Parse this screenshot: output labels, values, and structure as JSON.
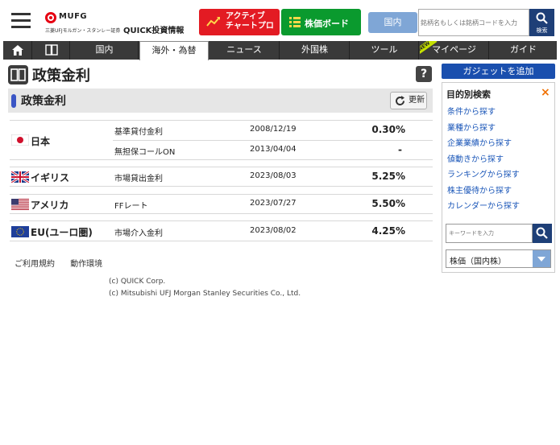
{
  "header": {
    "logo_mufg": "MUFG",
    "logo_sub": "三菱UFJモルガン・スタンレー証券",
    "logo_quick": "QUICK投資情報",
    "active_chart_line1": "アクティブ",
    "active_chart_line2": "チャートプロ",
    "stock_board": "株価ボード",
    "domestic": "国内",
    "search_placeholder": "銘柄名もしくは銘柄コードを入力",
    "search_label": "検索"
  },
  "nav": {
    "items": [
      "国内",
      "海外・為替",
      "ニュース",
      "外国株",
      "ツール",
      "マイページ",
      "ガイド"
    ],
    "new_badge": "NEW",
    "active": "海外・為替"
  },
  "page": {
    "title": "政策金利",
    "section_title": "政策金利",
    "refresh": "更新",
    "help": "?"
  },
  "rates": [
    {
      "country": "日本",
      "flag": "japan-flag",
      "rows": [
        {
          "name": "基準貸付金利",
          "date": "2008/12/19",
          "value": "0.30%"
        },
        {
          "name": "無担保コールON",
          "date": "2013/04/04",
          "value": "-"
        }
      ]
    },
    {
      "country": "イギリス",
      "flag": "uk-flag",
      "rows": [
        {
          "name": "市場貸出金利",
          "date": "2023/08/03",
          "value": "5.25%"
        }
      ]
    },
    {
      "country": "アメリカ",
      "flag": "us-flag",
      "rows": [
        {
          "name": "FFレート",
          "date": "2023/07/27",
          "value": "5.50%"
        }
      ]
    },
    {
      "country": "EU(ユーロ圏)",
      "flag": "eu-flag",
      "rows": [
        {
          "name": "市場介入金利",
          "date": "2023/08/02",
          "value": "4.25%"
        }
      ]
    }
  ],
  "footer": {
    "terms": "ご利用規約",
    "environment": "動作環境",
    "copyright1": "(c) QUICK Corp.",
    "copyright2": "(c) Mitsubishi UFJ Morgan Stanley Securities Co., Ltd."
  },
  "sidebar": {
    "add_gadget": "ガジェットを追加",
    "panel_title": "目的別検索",
    "close": "×",
    "links": [
      "条件から探す",
      "業種から探す",
      "企業業績から探す",
      "値動きから探す",
      "ランキングから探す",
      "株主優待から探す",
      "カレンダーから探す"
    ],
    "keyword_placeholder": "キーワードを入力",
    "select_value": "株価（国内株）"
  },
  "colors": {
    "active_red": "#e31b23",
    "board_green": "#0a9a2e",
    "navy": "#1e3f77",
    "link_blue": "#1a56b8",
    "nav_dark": "#3a3a3a"
  }
}
